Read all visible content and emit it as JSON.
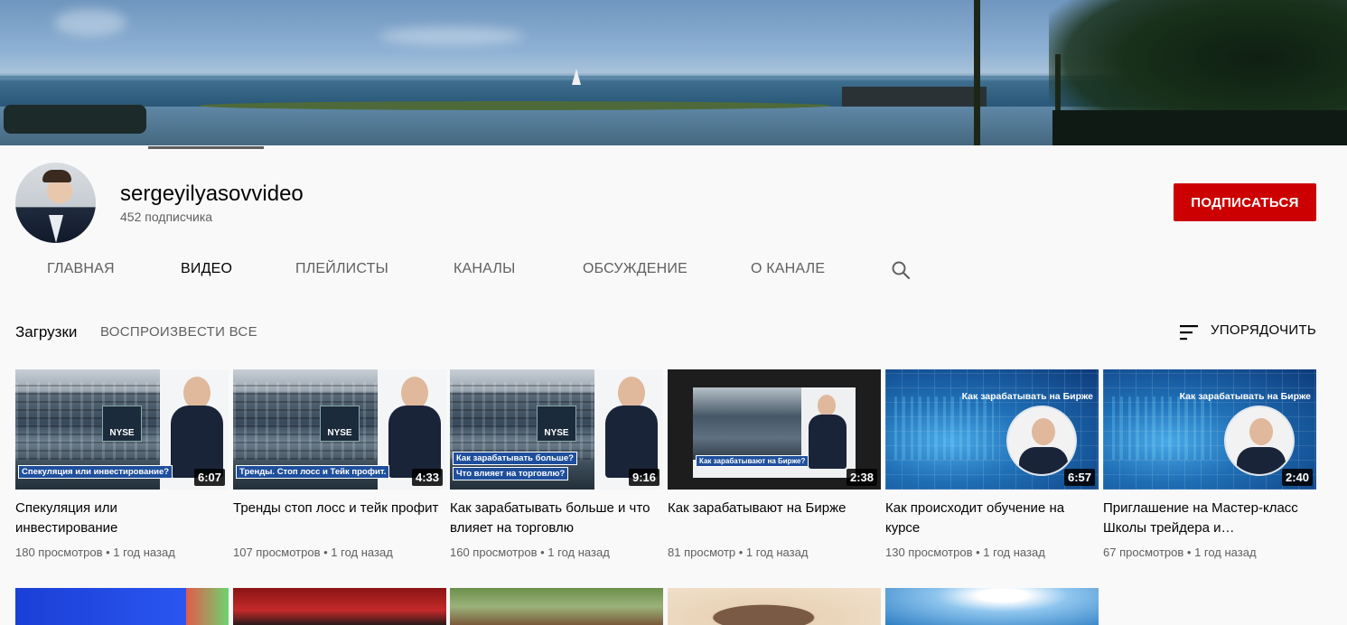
{
  "channel": {
    "name": "sergeyilyasovvideo",
    "subscribers": "452 подписчика",
    "subscribe_label": "ПОДПИСАТЬСЯ"
  },
  "tabs": [
    {
      "label": "ГЛАВНАЯ",
      "active": false
    },
    {
      "label": "ВИДЕО",
      "active": true
    },
    {
      "label": "ПЛЕЙЛИСТЫ",
      "active": false
    },
    {
      "label": "КАНАЛЫ",
      "active": false
    },
    {
      "label": "ОБСУЖДЕНИЕ",
      "active": false
    },
    {
      "label": "О КАНАЛЕ",
      "active": false
    }
  ],
  "icons": {
    "search": "search-icon",
    "sort": "sort-icon"
  },
  "section": {
    "title": "Загрузки",
    "play_all": "ВОСПРОИЗВЕСТИ ВСЕ",
    "sort_label": "УПОРЯДОЧИТЬ"
  },
  "videos": [
    {
      "title": "Спекуляция или инвестирование",
      "views": "180 просмотров",
      "age": "1 год назад",
      "duration": "6:07",
      "caption": "Спекуляция или инвестирование?"
    },
    {
      "title": "Тренды стоп лосс и тейк профит",
      "views": "107 просмотров",
      "age": "1 год назад",
      "duration": "4:33",
      "caption": "Тренды. Стоп лосс и Тейк профит."
    },
    {
      "title": "Как зарабатывать больше и что влияет на торговлю",
      "views": "160 просмотров",
      "age": "1 год назад",
      "duration": "9:16",
      "caption_line1": "Как зарабатывать больше?",
      "caption_line2": "Что влияет на торговлю?"
    },
    {
      "title": "Как зарабатывают на Бирже",
      "views": "81 просмотр",
      "age": "1 год назад",
      "duration": "2:38",
      "caption": "Как зарабатывают на Бирже?"
    },
    {
      "title": "Как происходит обучение на курсе",
      "views": "130 просмотров",
      "age": "1 год назад",
      "duration": "6:57",
      "thumb_text": "Как зарабатывать на Бирже"
    },
    {
      "title": "Приглашение на Мастер-класс Школы трейдера и…",
      "views": "67 просмотров",
      "age": "1 год назад",
      "duration": "2:40",
      "thumb_text": "Как зарабатывать на Бирже"
    }
  ],
  "colors": {
    "subscribe": "#cc0000",
    "background": "#f9f9f9",
    "secondary_text": "#606060"
  }
}
